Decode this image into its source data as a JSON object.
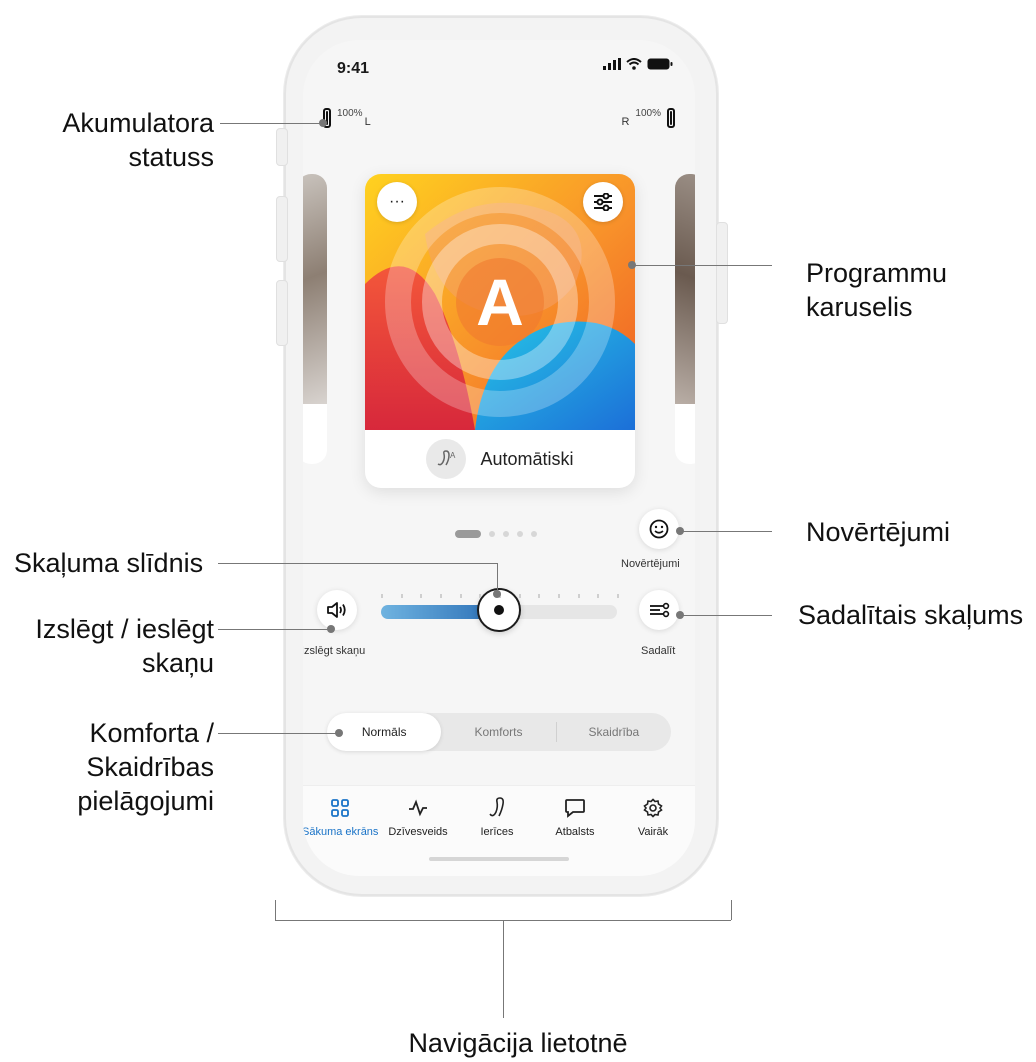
{
  "status": {
    "time": "9:41"
  },
  "battery": {
    "left": {
      "percent": "100%",
      "side": "L"
    },
    "right": {
      "percent": "100%",
      "side": "R"
    }
  },
  "program": {
    "letter": "A",
    "name": "Automātiski",
    "menu_icon": "ellipsis-icon",
    "settings_icon": "sliders-icon"
  },
  "carousel": {
    "page_count": 5,
    "active_page": 1
  },
  "volume": {
    "level": 0.5,
    "mute_label": "Izslēgt skaņu",
    "split_label": "Sadalīt"
  },
  "ratings": {
    "label": "Novērtējumi"
  },
  "sound_mode": {
    "options": [
      "Normāls",
      "Komforts",
      "Skaidrība"
    ],
    "selected": "Normāls"
  },
  "nav": {
    "items": [
      {
        "label": "Sākuma ekrāns",
        "icon": "grid-icon",
        "active": true
      },
      {
        "label": "Dzīvesveids",
        "icon": "activity-icon",
        "active": false
      },
      {
        "label": "Ierīces",
        "icon": "hearing-aid-icon",
        "active": false
      },
      {
        "label": "Atbalsts",
        "icon": "chat-icon",
        "active": false
      },
      {
        "label": "Vairāk",
        "icon": "gear-icon",
        "active": false
      }
    ]
  },
  "annotations": {
    "battery": "Akumulatora statuss",
    "carousel": "Programmu karuselis",
    "ratings": "Novērtējumi",
    "volume_slider": "Skaļuma slīdnis",
    "mute": "Izslēgt / ieslēgt skaņu",
    "split": "Sadalītais skaļums",
    "comfort": "Komforta / Skaidrības pielāgojumi",
    "navigation": "Navigācija lietotnē"
  },
  "colors": {
    "accent": "#1a73c7",
    "slider_fill_start": "#6fb3e0",
    "slider_fill_end": "#2b6fb6"
  }
}
